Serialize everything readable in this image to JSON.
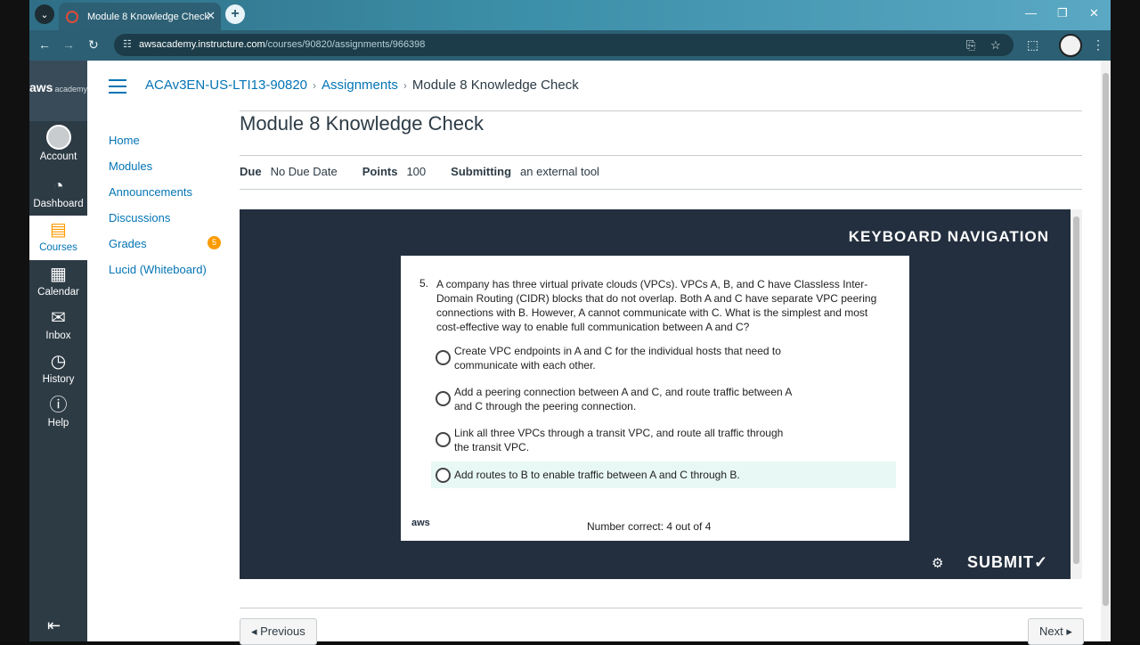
{
  "browser": {
    "tab_title": "Module 8 Knowledge Check",
    "url_host": "awsacademy.instructure.com",
    "url_path": "/courses/90820/assignments/966398"
  },
  "globalnav": {
    "logo": "aws",
    "logo_sub": "academy",
    "items": [
      {
        "label": "Account",
        "icon": "account-icon"
      },
      {
        "label": "Dashboard",
        "icon": "dashboard-icon"
      },
      {
        "label": "Courses",
        "icon": "courses-icon"
      },
      {
        "label": "Calendar",
        "icon": "calendar-icon"
      },
      {
        "label": "Inbox",
        "icon": "inbox-icon"
      },
      {
        "label": "History",
        "icon": "history-icon"
      },
      {
        "label": "Help",
        "icon": "help-icon"
      }
    ]
  },
  "breadcrumb": {
    "course": "ACAv3EN-US-LTI13-90820",
    "section": "Assignments",
    "current": "Module 8 Knowledge Check"
  },
  "coursenav": {
    "items": [
      "Home",
      "Modules",
      "Announcements",
      "Discussions",
      "Grades",
      "Lucid (Whiteboard)"
    ],
    "grades_badge": "5"
  },
  "assignment": {
    "title": "Module 8 Knowledge Check",
    "due_label": "Due",
    "due_value": "No Due Date",
    "points_label": "Points",
    "points_value": "100",
    "submitting_label": "Submitting",
    "submitting_value": "an external tool"
  },
  "tool": {
    "keyboard_nav": "KEYBOARD NAVIGATION",
    "question_number": "5.",
    "question": "A company has three virtual private clouds (VPCs). VPCs A, B, and C have Classless Inter-Domain Routing (CIDR) blocks that do not overlap. Both A and C have separate VPC peering connections with B. However, A cannot communicate with C. What is the simplest and most cost-effective way to enable full communication between A and C?",
    "options": [
      "Create VPC endpoints in A and C for the individual hosts that need to communicate with each other.",
      "Add a peering connection between A and C, and route traffic between A and C through the peering connection.",
      "Link all three VPCs through a transit VPC, and route all traffic through the transit VPC.",
      "Add routes to B to enable traffic between A and C through B."
    ],
    "logo": "aws",
    "score": "Number correct: 4 out of 4",
    "submit": "SUBMIT✓"
  },
  "footer": {
    "previous": "◂ Previous",
    "next": "Next ▸"
  },
  "colors": {
    "link": "#0374b5",
    "nav_bg": "#2d3b45",
    "tool_bg": "#232f3e",
    "badge": "#fc9b00"
  }
}
